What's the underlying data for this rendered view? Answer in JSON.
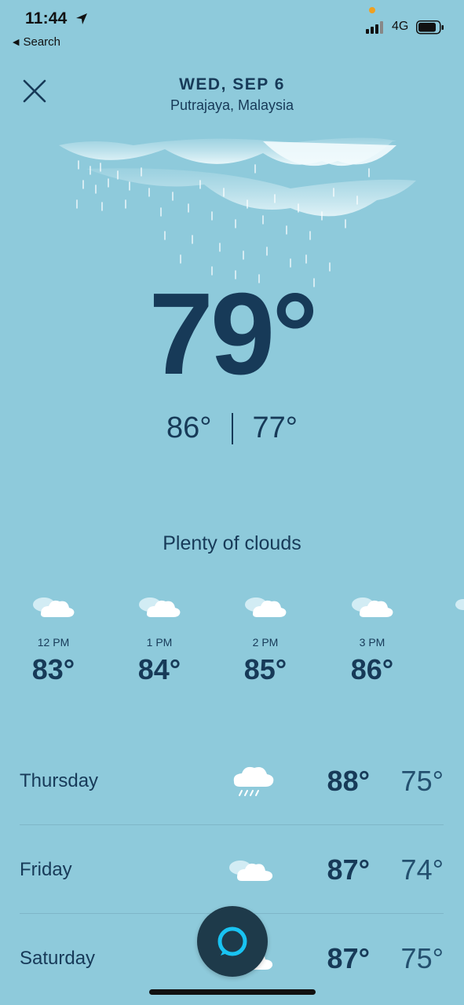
{
  "status_bar": {
    "time": "11:44",
    "back_label": "Search",
    "network": "4G"
  },
  "header": {
    "date": "WED, SEP 6",
    "location": "Putrajaya, Malaysia"
  },
  "current": {
    "temp": "79°",
    "high": "86°",
    "low": "77°",
    "condition": "Plenty of clouds"
  },
  "hourly": [
    {
      "time": "12 PM",
      "temp": "83°",
      "icon": "partly-cloudy-icon"
    },
    {
      "time": "1 PM",
      "temp": "84°",
      "icon": "partly-cloudy-icon"
    },
    {
      "time": "2 PM",
      "temp": "85°",
      "icon": "partly-cloudy-icon"
    },
    {
      "time": "3 PM",
      "temp": "86°",
      "icon": "partly-cloudy-icon"
    }
  ],
  "daily": [
    {
      "day": "Thursday",
      "high": "88°",
      "low": "75°",
      "icon": "rain-cloud-icon"
    },
    {
      "day": "Friday",
      "high": "87°",
      "low": "74°",
      "icon": "partly-cloudy-icon"
    },
    {
      "day": "Saturday",
      "high": "87°",
      "low": "75°",
      "icon": "partly-cloudy-icon"
    }
  ],
  "colors": {
    "background": "#8ecadb",
    "text": "#173a58",
    "alexa_button": "#1e3a4a",
    "alexa_ring": "#19c3f2"
  }
}
